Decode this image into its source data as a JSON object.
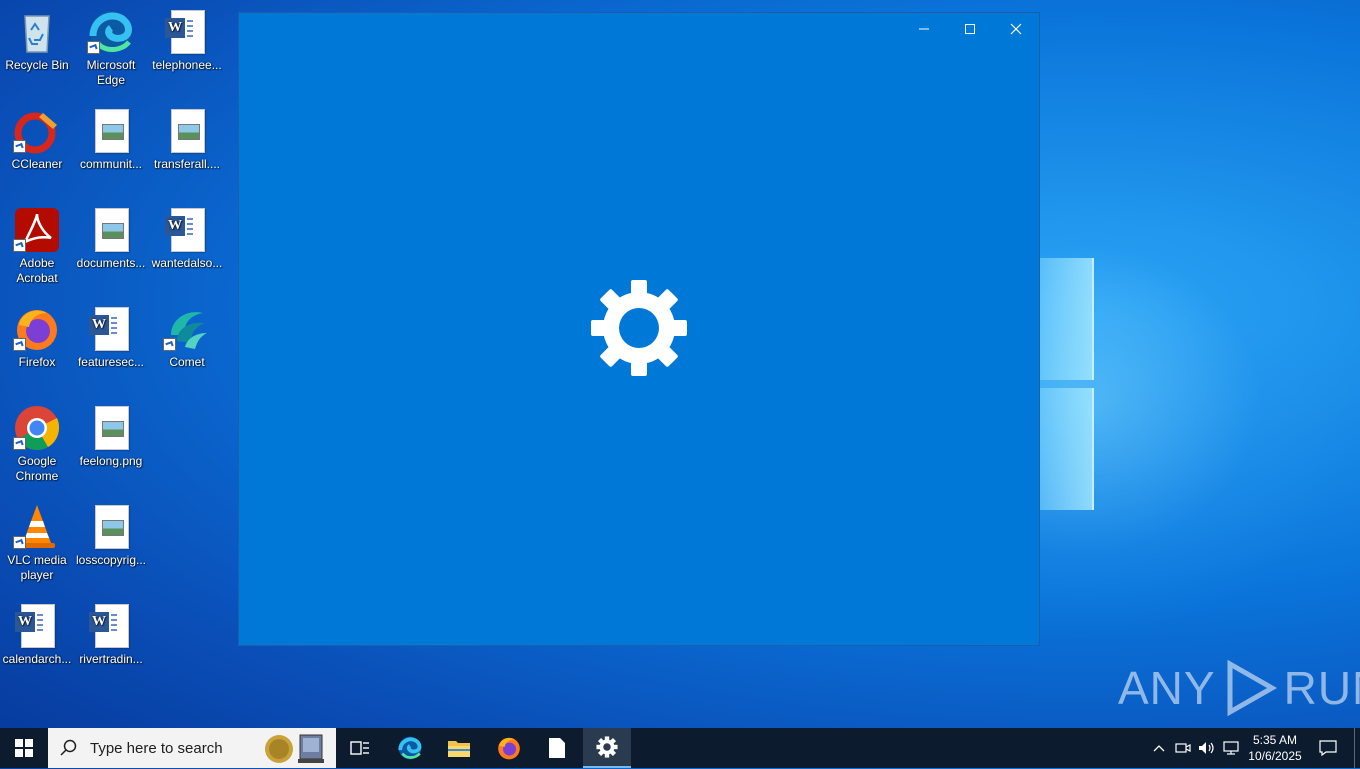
{
  "desktop": {
    "icons": [
      {
        "label": "Recycle Bin",
        "icon": "recycle-bin-icon"
      },
      {
        "label": "Microsoft Edge",
        "icon": "edge-icon"
      },
      {
        "label": "telephonee...",
        "icon": "word-doc-icon"
      },
      {
        "label": "CCleaner",
        "icon": "ccleaner-icon"
      },
      {
        "label": "communit...",
        "icon": "image-file-icon"
      },
      {
        "label": "transferall....",
        "icon": "image-file-icon"
      },
      {
        "label": "Adobe Acrobat",
        "icon": "acrobat-icon"
      },
      {
        "label": "documents...",
        "icon": "image-file-icon"
      },
      {
        "label": "wantedalso...",
        "icon": "word-doc-icon"
      },
      {
        "label": "Firefox",
        "icon": "firefox-icon"
      },
      {
        "label": "featuresec...",
        "icon": "word-doc-icon"
      },
      {
        "label": "Comet",
        "icon": "comet-icon"
      },
      {
        "label": "Google Chrome",
        "icon": "chrome-icon"
      },
      {
        "label": "feelong.png",
        "icon": "image-file-icon"
      },
      {
        "label": "VLC media player",
        "icon": "vlc-icon"
      },
      {
        "label": "losscopyrig...",
        "icon": "image-file-icon"
      },
      {
        "label": "calendarch...",
        "icon": "word-doc-icon"
      },
      {
        "label": "rivertradin...",
        "icon": "word-doc-icon"
      }
    ]
  },
  "window": {
    "minimize_icon": "minimize-icon",
    "maximize_icon": "maximize-icon",
    "close_icon": "close-icon",
    "loading_icon": "gear-icon",
    "background_color": "#0078d7"
  },
  "taskbar": {
    "search_placeholder": "Type here to search",
    "clock_time": "5:35 AM",
    "clock_date": "10/6/2025",
    "background_color": "#0c1b2e"
  },
  "watermark": {
    "left": "ANY",
    "right": "RUN"
  }
}
